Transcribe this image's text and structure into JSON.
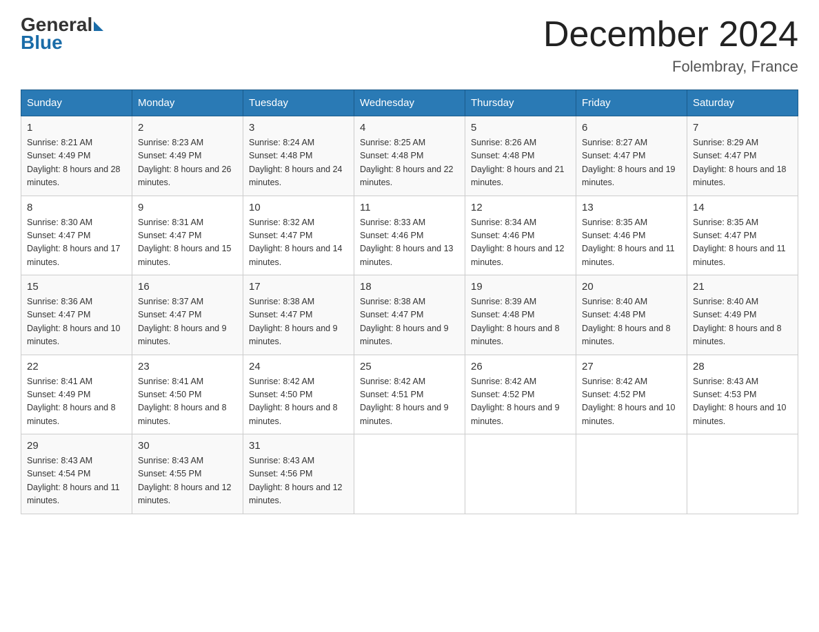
{
  "logo": {
    "general": "General",
    "blue": "Blue"
  },
  "title": "December 2024",
  "location": "Folembray, France",
  "days_of_week": [
    "Sunday",
    "Monday",
    "Tuesday",
    "Wednesday",
    "Thursday",
    "Friday",
    "Saturday"
  ],
  "weeks": [
    [
      {
        "num": "1",
        "sunrise": "8:21 AM",
        "sunset": "4:49 PM",
        "daylight": "8 hours and 28 minutes."
      },
      {
        "num": "2",
        "sunrise": "8:23 AM",
        "sunset": "4:49 PM",
        "daylight": "8 hours and 26 minutes."
      },
      {
        "num": "3",
        "sunrise": "8:24 AM",
        "sunset": "4:48 PM",
        "daylight": "8 hours and 24 minutes."
      },
      {
        "num": "4",
        "sunrise": "8:25 AM",
        "sunset": "4:48 PM",
        "daylight": "8 hours and 22 minutes."
      },
      {
        "num": "5",
        "sunrise": "8:26 AM",
        "sunset": "4:48 PM",
        "daylight": "8 hours and 21 minutes."
      },
      {
        "num": "6",
        "sunrise": "8:27 AM",
        "sunset": "4:47 PM",
        "daylight": "8 hours and 19 minutes."
      },
      {
        "num": "7",
        "sunrise": "8:29 AM",
        "sunset": "4:47 PM",
        "daylight": "8 hours and 18 minutes."
      }
    ],
    [
      {
        "num": "8",
        "sunrise": "8:30 AM",
        "sunset": "4:47 PM",
        "daylight": "8 hours and 17 minutes."
      },
      {
        "num": "9",
        "sunrise": "8:31 AM",
        "sunset": "4:47 PM",
        "daylight": "8 hours and 15 minutes."
      },
      {
        "num": "10",
        "sunrise": "8:32 AM",
        "sunset": "4:47 PM",
        "daylight": "8 hours and 14 minutes."
      },
      {
        "num": "11",
        "sunrise": "8:33 AM",
        "sunset": "4:46 PM",
        "daylight": "8 hours and 13 minutes."
      },
      {
        "num": "12",
        "sunrise": "8:34 AM",
        "sunset": "4:46 PM",
        "daylight": "8 hours and 12 minutes."
      },
      {
        "num": "13",
        "sunrise": "8:35 AM",
        "sunset": "4:46 PM",
        "daylight": "8 hours and 11 minutes."
      },
      {
        "num": "14",
        "sunrise": "8:35 AM",
        "sunset": "4:47 PM",
        "daylight": "8 hours and 11 minutes."
      }
    ],
    [
      {
        "num": "15",
        "sunrise": "8:36 AM",
        "sunset": "4:47 PM",
        "daylight": "8 hours and 10 minutes."
      },
      {
        "num": "16",
        "sunrise": "8:37 AM",
        "sunset": "4:47 PM",
        "daylight": "8 hours and 9 minutes."
      },
      {
        "num": "17",
        "sunrise": "8:38 AM",
        "sunset": "4:47 PM",
        "daylight": "8 hours and 9 minutes."
      },
      {
        "num": "18",
        "sunrise": "8:38 AM",
        "sunset": "4:47 PM",
        "daylight": "8 hours and 9 minutes."
      },
      {
        "num": "19",
        "sunrise": "8:39 AM",
        "sunset": "4:48 PM",
        "daylight": "8 hours and 8 minutes."
      },
      {
        "num": "20",
        "sunrise": "8:40 AM",
        "sunset": "4:48 PM",
        "daylight": "8 hours and 8 minutes."
      },
      {
        "num": "21",
        "sunrise": "8:40 AM",
        "sunset": "4:49 PM",
        "daylight": "8 hours and 8 minutes."
      }
    ],
    [
      {
        "num": "22",
        "sunrise": "8:41 AM",
        "sunset": "4:49 PM",
        "daylight": "8 hours and 8 minutes."
      },
      {
        "num": "23",
        "sunrise": "8:41 AM",
        "sunset": "4:50 PM",
        "daylight": "8 hours and 8 minutes."
      },
      {
        "num": "24",
        "sunrise": "8:42 AM",
        "sunset": "4:50 PM",
        "daylight": "8 hours and 8 minutes."
      },
      {
        "num": "25",
        "sunrise": "8:42 AM",
        "sunset": "4:51 PM",
        "daylight": "8 hours and 9 minutes."
      },
      {
        "num": "26",
        "sunrise": "8:42 AM",
        "sunset": "4:52 PM",
        "daylight": "8 hours and 9 minutes."
      },
      {
        "num": "27",
        "sunrise": "8:42 AM",
        "sunset": "4:52 PM",
        "daylight": "8 hours and 10 minutes."
      },
      {
        "num": "28",
        "sunrise": "8:43 AM",
        "sunset": "4:53 PM",
        "daylight": "8 hours and 10 minutes."
      }
    ],
    [
      {
        "num": "29",
        "sunrise": "8:43 AM",
        "sunset": "4:54 PM",
        "daylight": "8 hours and 11 minutes."
      },
      {
        "num": "30",
        "sunrise": "8:43 AM",
        "sunset": "4:55 PM",
        "daylight": "8 hours and 12 minutes."
      },
      {
        "num": "31",
        "sunrise": "8:43 AM",
        "sunset": "4:56 PM",
        "daylight": "8 hours and 12 minutes."
      },
      null,
      null,
      null,
      null
    ]
  ]
}
